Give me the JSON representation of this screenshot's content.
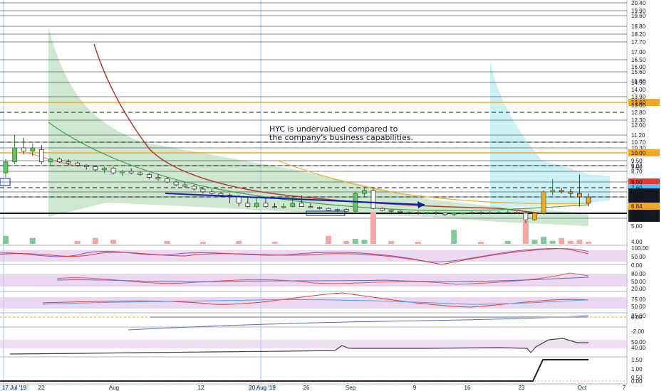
{
  "chart_data": {
    "type": "candlestick",
    "symbol": "HYC",
    "annotation": [
      "HYC is undervalued compared to",
      "the company's business capabilities."
    ],
    "price_ticks": [
      "20.40",
      "19.90",
      "19.60",
      "18.80",
      "18.20",
      "17.70",
      "17.00",
      "16.50",
      "16.00",
      "15.60",
      "15.00",
      "14.90",
      "14.00",
      "13.90",
      "13.60",
      "13.00",
      "12.80",
      "12.30",
      "12.00",
      "11.20",
      "10.70",
      "10.30",
      "10.00",
      "9.50",
      "9.07",
      "9.00",
      "8.70",
      "8.00",
      "7.60",
      "7.29",
      "7.00",
      "6.94",
      "6.84",
      "6.09",
      "6.00",
      "5.75",
      "5.00",
      "4.00"
    ],
    "highlighted_prices": [
      {
        "label": "8.00",
        "value": 8.0,
        "color": "#e53935"
      },
      {
        "label": "7.60",
        "value": 7.6,
        "color": "#4fc3f7"
      },
      {
        "label": "7.29",
        "value": 7.29,
        "color": "#131722"
      },
      {
        "label": "7.00",
        "value": 7.0,
        "color": "#131722"
      },
      {
        "label": "6.94",
        "value": 6.94,
        "color": "#131722"
      },
      {
        "label": "6.84",
        "value": 6.84,
        "color": "#f5a623"
      },
      {
        "label": "6.09",
        "value": 6.09,
        "color": "#131722"
      },
      {
        "label": "5.75",
        "value": 5.75,
        "color": "#131722"
      },
      {
        "label": "13.60",
        "value": 13.6,
        "color": "#f5a623"
      },
      {
        "label": "10.00",
        "value": 10.0,
        "color": "#f5a623"
      }
    ],
    "horizontal_levels_solid": [
      20.4,
      19.9,
      19.6,
      18.8,
      18.2,
      17.7,
      16.5,
      15.6,
      14.9,
      13.9,
      12.3,
      11.2,
      10.7,
      10.3,
      9.5,
      9.07,
      8.7,
      8.0,
      7.29,
      7.0,
      6.09,
      5.75
    ],
    "horizontal_levels_dashed": [
      12.8,
      10.7,
      9.07,
      7.6,
      7.0
    ],
    "horizontal_levels_orange": [
      13.6,
      10.0
    ],
    "x_labels": [
      "17 Jul '19",
      "22",
      "Aug",
      "12",
      "20 Aug '19",
      "26",
      "Sep",
      "9",
      "16",
      "23",
      "Oct",
      "7"
    ],
    "candles": [
      [
        0,
        8.6,
        9.6,
        8.3,
        9.4
      ],
      [
        1,
        9.4,
        11.2,
        9.2,
        10.3
      ],
      [
        2,
        10.3,
        11.0,
        9.9,
        10.1
      ],
      [
        3,
        10.1,
        10.6,
        9.8,
        10.3
      ],
      [
        4,
        10.2,
        10.5,
        9.2,
        9.4
      ],
      [
        5,
        9.4,
        9.7,
        9.1,
        9.6
      ],
      [
        6,
        9.6,
        9.7,
        9.3,
        9.4
      ],
      [
        7,
        9.4,
        9.6,
        9.1,
        9.3
      ],
      [
        8,
        9.3,
        9.4,
        9.0,
        9.1
      ],
      [
        9,
        9.1,
        9.2,
        8.8,
        9.0
      ],
      [
        10,
        9.0,
        9.1,
        8.7,
        8.8
      ],
      [
        11,
        8.8,
        9.0,
        8.6,
        8.9
      ],
      [
        12,
        8.9,
        9.0,
        8.5,
        8.6
      ],
      [
        13,
        8.6,
        8.8,
        8.4,
        8.7
      ],
      [
        14,
        8.7,
        8.9,
        8.5,
        8.6
      ],
      [
        15,
        8.6,
        8.7,
        8.4,
        8.5
      ],
      [
        16,
        8.5,
        8.6,
        8.2,
        8.3
      ],
      [
        17,
        8.3,
        8.5,
        8.1,
        8.2
      ],
      [
        18,
        8.2,
        8.3,
        7.9,
        8.0
      ],
      [
        19,
        8.0,
        8.1,
        7.7,
        7.8
      ],
      [
        20,
        7.8,
        8.0,
        7.6,
        7.7
      ],
      [
        21,
        7.7,
        7.8,
        7.4,
        7.5
      ],
      [
        22,
        7.5,
        7.6,
        7.2,
        7.3
      ],
      [
        23,
        7.3,
        7.5,
        7.1,
        7.2
      ],
      [
        24,
        7.2,
        7.3,
        7.0,
        7.1
      ],
      [
        25,
        7.1,
        7.2,
        6.9,
        7.0
      ],
      [
        26,
        7.0,
        7.1,
        6.8,
        6.9
      ],
      [
        27,
        6.9,
        7.0,
        6.7,
        6.8
      ],
      [
        28,
        6.8,
        7.0,
        6.6,
        6.9
      ],
      [
        29,
        6.9,
        7.0,
        6.7,
        6.8
      ],
      [
        30,
        6.8,
        6.9,
        6.6,
        6.7
      ],
      [
        31,
        6.7,
        6.9,
        6.6,
        6.8
      ],
      [
        32,
        6.8,
        7.0,
        6.7,
        6.9
      ],
      [
        33,
        6.9,
        7.1,
        6.8,
        6.8
      ],
      [
        34,
        6.8,
        6.9,
        6.6,
        6.7
      ],
      [
        35,
        6.7,
        6.8,
        6.5,
        6.6
      ],
      [
        36,
        6.6,
        6.7,
        6.3,
        6.4
      ],
      [
        37,
        6.4,
        6.6,
        6.2,
        6.5
      ],
      [
        38,
        6.5,
        6.6,
        6.2,
        6.3
      ],
      [
        39,
        6.3,
        7.3,
        6.2,
        7.2
      ],
      [
        40,
        7.2,
        7.6,
        7.0,
        7.4
      ],
      [
        41,
        7.4,
        7.5,
        6.5,
        6.6
      ],
      [
        42,
        6.6,
        6.7,
        6.3,
        6.4
      ],
      [
        43,
        6.4,
        6.5,
        6.2,
        6.3
      ],
      [
        44,
        6.3,
        6.4,
        6.1,
        6.2
      ],
      [
        45,
        6.2,
        6.3,
        6.0,
        6.2
      ],
      [
        46,
        6.2,
        6.3,
        6.0,
        6.1
      ],
      [
        47,
        6.1,
        6.2,
        6.0,
        6.2
      ],
      [
        48,
        6.2,
        6.3,
        6.0,
        6.1
      ],
      [
        49,
        6.1,
        6.2,
        5.9,
        6.0
      ],
      [
        50,
        6.0,
        6.2,
        5.9,
        6.1
      ],
      [
        51,
        6.1,
        6.2,
        6.0,
        6.1
      ],
      [
        52,
        6.1,
        6.3,
        6.0,
        6.2
      ],
      [
        53,
        6.2,
        6.3,
        6.0,
        6.1
      ],
      [
        54,
        6.1,
        6.3,
        6.0,
        6.2
      ],
      [
        55,
        6.2,
        6.3,
        6.1,
        6.2
      ],
      [
        56,
        6.2,
        6.4,
        6.1,
        6.2
      ],
      [
        57,
        6.2,
        6.3,
        6.1,
        6.1
      ],
      [
        58,
        6.1,
        6.3,
        5.3,
        5.6
      ],
      [
        59,
        5.6,
        6.2,
        5.5,
        6.1
      ],
      [
        60,
        6.1,
        7.4,
        6.0,
        7.3
      ],
      [
        61,
        7.3,
        8.2,
        7.1,
        7.4
      ],
      [
        62,
        7.4,
        7.6,
        7.2,
        7.3
      ],
      [
        63,
        7.3,
        7.5,
        7.0,
        7.2
      ],
      [
        64,
        7.2,
        8.5,
        6.8,
        7.0
      ],
      [
        65,
        7.0,
        7.2,
        6.8,
        6.9
      ]
    ],
    "volume": [
      [
        0,
        0.8
      ],
      [
        3,
        0.6
      ],
      [
        8,
        0.3
      ],
      [
        10,
        0.6
      ],
      [
        12,
        0.4
      ],
      [
        18,
        0.3
      ],
      [
        22,
        0.2
      ],
      [
        26,
        0.3
      ],
      [
        30,
        0.2
      ],
      [
        36,
        0.8
      ],
      [
        38,
        0.3
      ],
      [
        39,
        0.5
      ],
      [
        40,
        0.4
      ],
      [
        41,
        3.2
      ],
      [
        43,
        0.3
      ],
      [
        46,
        0.2
      ],
      [
        50,
        1.4
      ],
      [
        53,
        0.2
      ],
      [
        56,
        0.3
      ],
      [
        58,
        2.3
      ],
      [
        59,
        0.4
      ],
      [
        60,
        0.7
      ],
      [
        61,
        0.3
      ],
      [
        62,
        0.6
      ],
      [
        63,
        0.3
      ],
      [
        64,
        0.4
      ],
      [
        65,
        0.2
      ]
    ],
    "osc_labels": [
      {
        "pane": 1,
        "ticks": [
          "100.00",
          "50.00",
          "0.00"
        ],
        "badge": "50.00"
      },
      {
        "pane": 2,
        "ticks": [
          "80.00",
          "50.00",
          "20.00"
        ],
        "badge": "50.00"
      },
      {
        "pane": 3,
        "ticks": [
          "75.00",
          "50.00",
          "25.00"
        ],
        "badge": "50.00"
      },
      {
        "pane": 4,
        "ticks": [
          "0.00",
          "-2.00"
        ],
        "badge": "0.00"
      },
      {
        "pane": 5,
        "ticks": [
          "50.00",
          "40.00"
        ],
        "badge": "50.00"
      },
      {
        "pane": 6,
        "ticks": [
          "1.50",
          "1.00",
          "0.50",
          "0.00"
        ],
        "badge": "1.00"
      }
    ],
    "colors": {
      "up": "#26a69a",
      "down": "#ef5350",
      "green_cloud": "#a5d6a7",
      "cyan_cloud": "#b2ebf2",
      "band": "#e1bee7",
      "blue_arrow": "#0d1fb0",
      "orange_line": "#f5a623",
      "red_line": "#b23b2e",
      "green_line": "#43a047"
    }
  }
}
